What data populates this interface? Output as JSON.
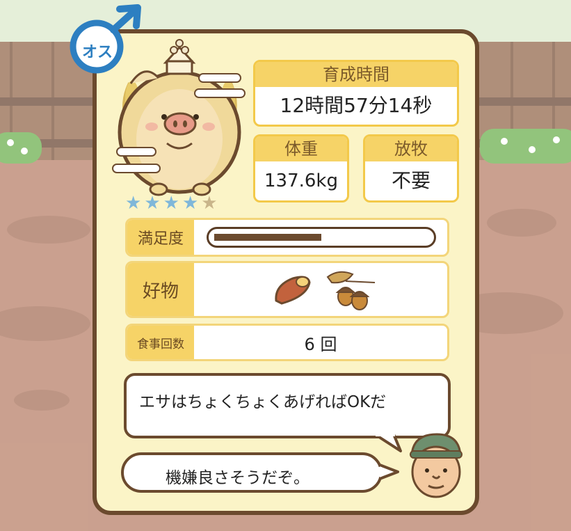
{
  "gender": {
    "label": "オス"
  },
  "stats": {
    "growth_time_label": "育成時間",
    "growth_time_value": "12時間57分14秒",
    "weight_label": "体重",
    "weight_value": "137.6kg",
    "grazing_label": "放牧",
    "grazing_value": "不要"
  },
  "rating": {
    "stars_filled": 4,
    "stars_total": 5
  },
  "satisfaction": {
    "label": "満足度",
    "level": 0.55
  },
  "favorite": {
    "label": "好物",
    "items": [
      "sweet-potato-icon",
      "acorn-icon"
    ]
  },
  "meals": {
    "label": "食事回数",
    "value": "6 回"
  },
  "dialog": {
    "advice": "エサはちょくちょくあげればOKだ",
    "mood": "機嫌良さそうだぞ。"
  },
  "colors": {
    "panel_bg": "#fbf4c7",
    "border": "#6b4a2e",
    "accent": "#f6d367",
    "gender_blue": "#2d7fc1"
  }
}
